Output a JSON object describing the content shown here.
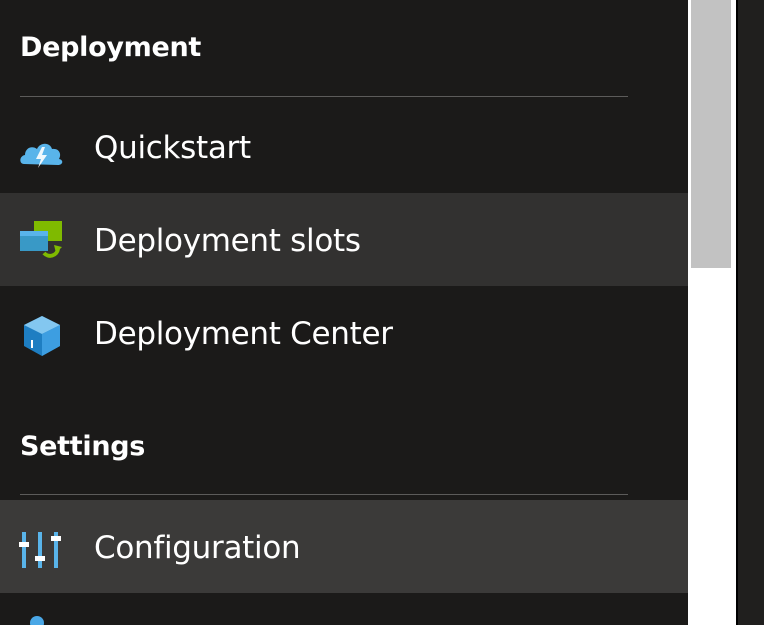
{
  "sidebar": {
    "sections": [
      {
        "title": "Deployment"
      },
      {
        "title": "Settings"
      }
    ],
    "items": [
      {
        "label": "Quickstart",
        "icon": "cloud-lightning-icon"
      },
      {
        "label": "Deployment slots",
        "icon": "deployment-slots-icon"
      },
      {
        "label": "Deployment Center",
        "icon": "deployment-center-cube-icon"
      },
      {
        "label": "Configuration",
        "icon": "configuration-sliders-icon"
      }
    ]
  },
  "colors": {
    "background": "#1b1a19",
    "selected": "#3b3a39",
    "hover": "#323130",
    "accent_blue": "#4aa7e6",
    "accent_green": "#7fba00"
  }
}
